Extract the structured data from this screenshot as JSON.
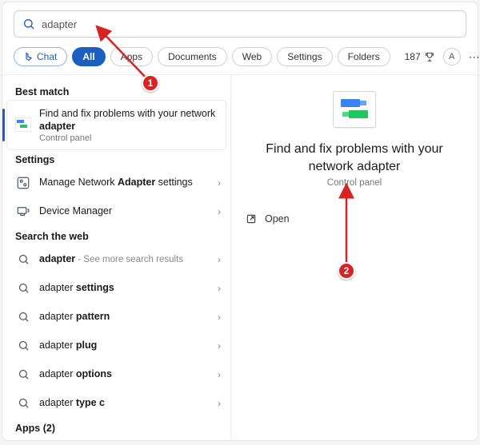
{
  "search": {
    "value": "adapter"
  },
  "filters": {
    "chat": "Chat",
    "all": "All",
    "apps": "Apps",
    "documents": "Documents",
    "web": "Web",
    "settings": "Settings",
    "folders": "Folders"
  },
  "rewards": "187",
  "avatar_letter": "A",
  "sections": {
    "best": "Best match",
    "settings": "Settings",
    "web": "Search the web",
    "apps_count": "Apps (2)"
  },
  "best_match": {
    "line1": "Find and fix problems with your network",
    "line2_bold": "adapter",
    "sub": "Control panel"
  },
  "settings_items": [
    {
      "pre": "Manage Network ",
      "bold": "Adapter",
      "post": " settings"
    },
    {
      "pre": "Device Manager",
      "bold": "",
      "post": ""
    }
  ],
  "web_items": [
    {
      "bold": "adapter",
      "post": "",
      "grey": " - See more search results"
    },
    {
      "bold": "",
      "post": "adapter ",
      "bold2": "settings"
    },
    {
      "bold": "",
      "post": "adapter ",
      "bold2": "pattern"
    },
    {
      "bold": "",
      "post": "adapter ",
      "bold2": "plug"
    },
    {
      "bold": "",
      "post": "adapter ",
      "bold2": "options"
    },
    {
      "bold": "",
      "post": "adapter ",
      "bold2": "type c"
    }
  ],
  "detail": {
    "title": "Find and fix problems with your network adapter",
    "sub": "Control panel",
    "open": "Open"
  },
  "annotations": {
    "a1": "1",
    "a2": "2"
  }
}
